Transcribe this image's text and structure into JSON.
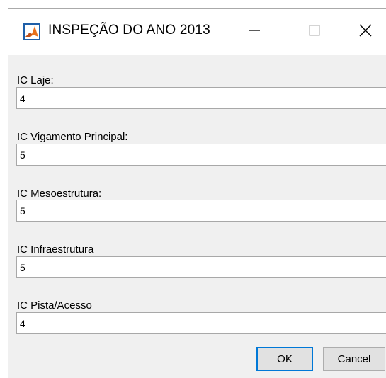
{
  "window": {
    "title": "INSPEÇÃO DO ANO 2013",
    "icons": {
      "app": "matlab-icon",
      "minimize": "minimize-icon",
      "maximize": "maximize-icon",
      "close": "close-icon"
    }
  },
  "form": {
    "fields": [
      {
        "label": "IC Laje:",
        "value": "4"
      },
      {
        "label": "IC Vigamento Principal:",
        "value": "5"
      },
      {
        "label": "IC Mesoestrutura:",
        "value": "5"
      },
      {
        "label": "IC Infraestrutura",
        "value": "5"
      },
      {
        "label": "IC Pista/Acesso",
        "value": "4"
      }
    ]
  },
  "buttons": {
    "ok_label": "OK",
    "cancel_label": "Cancel"
  },
  "colors": {
    "window_bg": "#f0f0f0",
    "titlebar_bg": "#ffffff",
    "focus_border": "#0078d7",
    "icon_orange": "#e8701a",
    "icon_blue": "#1f5fa8"
  }
}
